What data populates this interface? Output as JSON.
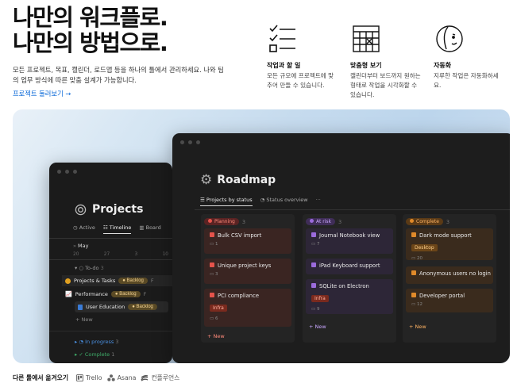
{
  "hero": {
    "title_line1": "나만의 워크플로.",
    "title_line2": "나만의 방법으로.",
    "description_line1": "모든 프로젝트, 목표, 캘린더, 로드맵 등을 하나의 툴에서 관리하세요. 나와 팀",
    "description_line2": "의 업무 방식에 따른 맞춤 설계가 가능합니다.",
    "link": "프로젝트 둘러보기 →"
  },
  "features": [
    {
      "icon": "checklist-icon",
      "title": "작업과 할 일",
      "desc_lines": [
        "모든 규모에 프로젝트에 맞",
        "추어 만들 수 있습니다."
      ]
    },
    {
      "icon": "calendar-icon",
      "title": "맞춤형 보기",
      "desc_lines": [
        "캘린더부터 보드까지 원하는",
        "형태로 작업을 시각화할 수",
        "있습니다."
      ]
    },
    {
      "icon": "automation-face-icon",
      "title": "자동화",
      "desc_lines": [
        "지루한 작업은 자동화하세",
        "요."
      ]
    }
  ],
  "projects_window": {
    "title": "Projects",
    "tabs": [
      "Active",
      "Timeline",
      "Board"
    ],
    "month": "May",
    "dates": [
      "20",
      "27",
      "3",
      "10"
    ],
    "todo_label": "To-do",
    "todo_count": "3",
    "rows": [
      {
        "label": "Projects & Tasks",
        "badge": "Backlog",
        "trail": "F"
      },
      {
        "label": "Performance",
        "badge": "Backlog",
        "trail": "F"
      },
      {
        "label": "User Education",
        "badge": "Backlog",
        "trail": ""
      }
    ],
    "new_label": "New",
    "in_progress_label": "In progress",
    "in_progress_count": "3",
    "complete_label": "Complete",
    "complete_count": "1"
  },
  "roadmap_window": {
    "title": "Roadmap",
    "tabs": [
      "Projects by status",
      "Status overview",
      "···"
    ],
    "columns": [
      {
        "label": "Planning",
        "count": "3",
        "pill_bg": "#5a2323",
        "pill_color": "#ff8a7a",
        "dot": "#e5534b",
        "card_bg": "#3a2522",
        "cards": [
          {
            "title": "Bulk CSV import",
            "meta": "1",
            "tag": ""
          },
          {
            "title": "Unique project keys",
            "meta": "3",
            "tag": ""
          },
          {
            "title": "PCI compliance",
            "meta": "6",
            "tag": "Infra"
          }
        ]
      },
      {
        "label": "At risk",
        "count": "3",
        "pill_bg": "#3f2d57",
        "pill_color": "#c9a7ff",
        "dot": "#9b6bdc",
        "card_bg": "#2d2637",
        "cards": [
          {
            "title": "Journal Notebook view",
            "meta": "7",
            "tag": ""
          },
          {
            "title": "iPad Keyboard support",
            "meta": "",
            "tag": ""
          },
          {
            "title": "SQLite on Electron",
            "meta": "9",
            "tag": "Infra"
          }
        ]
      },
      {
        "label": "Complete",
        "count": "3",
        "pill_bg": "#5a3a16",
        "pill_color": "#ffb363",
        "dot": "#e08a2a",
        "card_bg": "#3a2b1d",
        "cards": [
          {
            "title": "Dark mode support",
            "meta": "20",
            "tag": "Desktop"
          },
          {
            "title": "Anonymous users no login",
            "meta": "",
            "tag": ""
          },
          {
            "title": "Developer portal",
            "meta": "12",
            "tag": ""
          }
        ]
      }
    ],
    "new_label": "New"
  },
  "migrate": {
    "label": "다른 툴에서 옮겨오기",
    "tools": [
      "Trello",
      "Asana",
      "컨플루언스"
    ]
  }
}
